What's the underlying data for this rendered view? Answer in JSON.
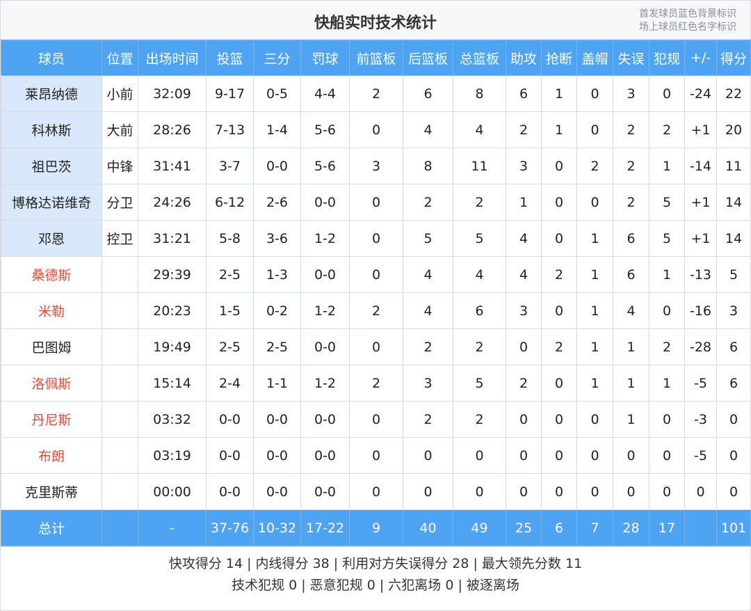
{
  "header": {
    "title": "快船实时技术统计",
    "legend_line1": "首发球员蓝色背景标识",
    "legend_line2": "场上球员红色名字标识"
  },
  "columns": [
    "球员",
    "位置",
    "出场时间",
    "投篮",
    "三分",
    "罚球",
    "前篮板",
    "后篮板",
    "总篮板",
    "助攻",
    "抢断",
    "盖帽",
    "失误",
    "犯规",
    "+/-",
    "得分"
  ],
  "players": [
    {
      "name": "莱昂纳德",
      "pos": "小前",
      "min": "32:09",
      "fg": "9-17",
      "tp": "0-5",
      "ft": "4-4",
      "oreb": "2",
      "dreb": "6",
      "reb": "8",
      "ast": "6",
      "stl": "1",
      "blk": "0",
      "to": "3",
      "pf": "0",
      "pm": "-24",
      "pts": "22",
      "starter": true,
      "on_court": false
    },
    {
      "name": "科林斯",
      "pos": "大前",
      "min": "28:26",
      "fg": "7-13",
      "tp": "1-4",
      "ft": "5-6",
      "oreb": "0",
      "dreb": "4",
      "reb": "4",
      "ast": "2",
      "stl": "1",
      "blk": "0",
      "to": "2",
      "pf": "2",
      "pm": "+1",
      "pts": "20",
      "starter": true,
      "on_court": false
    },
    {
      "name": "祖巴茨",
      "pos": "中锋",
      "min": "31:41",
      "fg": "3-7",
      "tp": "0-0",
      "ft": "5-6",
      "oreb": "3",
      "dreb": "8",
      "reb": "11",
      "ast": "3",
      "stl": "0",
      "blk": "2",
      "to": "2",
      "pf": "1",
      "pm": "-14",
      "pts": "11",
      "starter": true,
      "on_court": false
    },
    {
      "name": "博格达诺维奇",
      "pos": "分卫",
      "min": "24:26",
      "fg": "6-12",
      "tp": "2-6",
      "ft": "0-0",
      "oreb": "0",
      "dreb": "2",
      "reb": "2",
      "ast": "1",
      "stl": "0",
      "blk": "0",
      "to": "2",
      "pf": "5",
      "pm": "+1",
      "pts": "14",
      "starter": true,
      "on_court": false
    },
    {
      "name": "邓恩",
      "pos": "控卫",
      "min": "31:21",
      "fg": "5-8",
      "tp": "3-6",
      "ft": "1-2",
      "oreb": "0",
      "dreb": "5",
      "reb": "5",
      "ast": "4",
      "stl": "0",
      "blk": "1",
      "to": "6",
      "pf": "5",
      "pm": "+1",
      "pts": "14",
      "starter": true,
      "on_court": false
    },
    {
      "name": "桑德斯",
      "pos": "",
      "min": "29:39",
      "fg": "2-5",
      "tp": "1-3",
      "ft": "0-0",
      "oreb": "0",
      "dreb": "4",
      "reb": "4",
      "ast": "4",
      "stl": "2",
      "blk": "1",
      "to": "6",
      "pf": "1",
      "pm": "-13",
      "pts": "5",
      "starter": false,
      "on_court": true
    },
    {
      "name": "米勒",
      "pos": "",
      "min": "20:23",
      "fg": "1-5",
      "tp": "0-2",
      "ft": "1-2",
      "oreb": "2",
      "dreb": "4",
      "reb": "6",
      "ast": "3",
      "stl": "0",
      "blk": "1",
      "to": "4",
      "pf": "0",
      "pm": "-16",
      "pts": "3",
      "starter": false,
      "on_court": true
    },
    {
      "name": "巴图姆",
      "pos": "",
      "min": "19:49",
      "fg": "2-5",
      "tp": "2-5",
      "ft": "0-0",
      "oreb": "0",
      "dreb": "2",
      "reb": "2",
      "ast": "0",
      "stl": "2",
      "blk": "1",
      "to": "1",
      "pf": "2",
      "pm": "-28",
      "pts": "6",
      "starter": false,
      "on_court": false
    },
    {
      "name": "洛佩斯",
      "pos": "",
      "min": "15:14",
      "fg": "2-4",
      "tp": "1-1",
      "ft": "1-2",
      "oreb": "2",
      "dreb": "3",
      "reb": "5",
      "ast": "2",
      "stl": "0",
      "blk": "1",
      "to": "1",
      "pf": "1",
      "pm": "-5",
      "pts": "6",
      "starter": false,
      "on_court": true
    },
    {
      "name": "丹尼斯",
      "pos": "",
      "min": "03:32",
      "fg": "0-0",
      "tp": "0-0",
      "ft": "0-0",
      "oreb": "0",
      "dreb": "2",
      "reb": "2",
      "ast": "0",
      "stl": "0",
      "blk": "0",
      "to": "1",
      "pf": "0",
      "pm": "-3",
      "pts": "0",
      "starter": false,
      "on_court": true
    },
    {
      "name": "布朗",
      "pos": "",
      "min": "03:19",
      "fg": "0-0",
      "tp": "0-0",
      "ft": "0-0",
      "oreb": "0",
      "dreb": "0",
      "reb": "0",
      "ast": "0",
      "stl": "0",
      "blk": "0",
      "to": "0",
      "pf": "0",
      "pm": "-5",
      "pts": "0",
      "starter": false,
      "on_court": true
    },
    {
      "name": "克里斯蒂",
      "pos": "",
      "min": "00:00",
      "fg": "0-0",
      "tp": "0-0",
      "ft": "0-0",
      "oreb": "0",
      "dreb": "0",
      "reb": "0",
      "ast": "0",
      "stl": "0",
      "blk": "0",
      "to": "0",
      "pf": "0",
      "pm": "0",
      "pts": "0",
      "starter": false,
      "on_court": false
    }
  ],
  "totals": {
    "name": "总计",
    "pos": "",
    "min": "-",
    "fg": "37-76",
    "tp": "10-32",
    "ft": "17-22",
    "oreb": "9",
    "dreb": "40",
    "reb": "49",
    "ast": "25",
    "stl": "6",
    "blk": "7",
    "to": "28",
    "pf": "17",
    "pm": "",
    "pts": "101"
  },
  "footer": {
    "line1": "快攻得分 14 | 内线得分 38 | 利用对方失误得分 28 | 最大领先分数 11",
    "line2": "技术犯规 0 | 恶意犯规 0 | 六犯离场 0 | 被逐离场"
  },
  "colors": {
    "header_bg": "#4ea3f2",
    "starter_bg": "#d9e9fb",
    "on_court_name": "#f04a3c"
  }
}
